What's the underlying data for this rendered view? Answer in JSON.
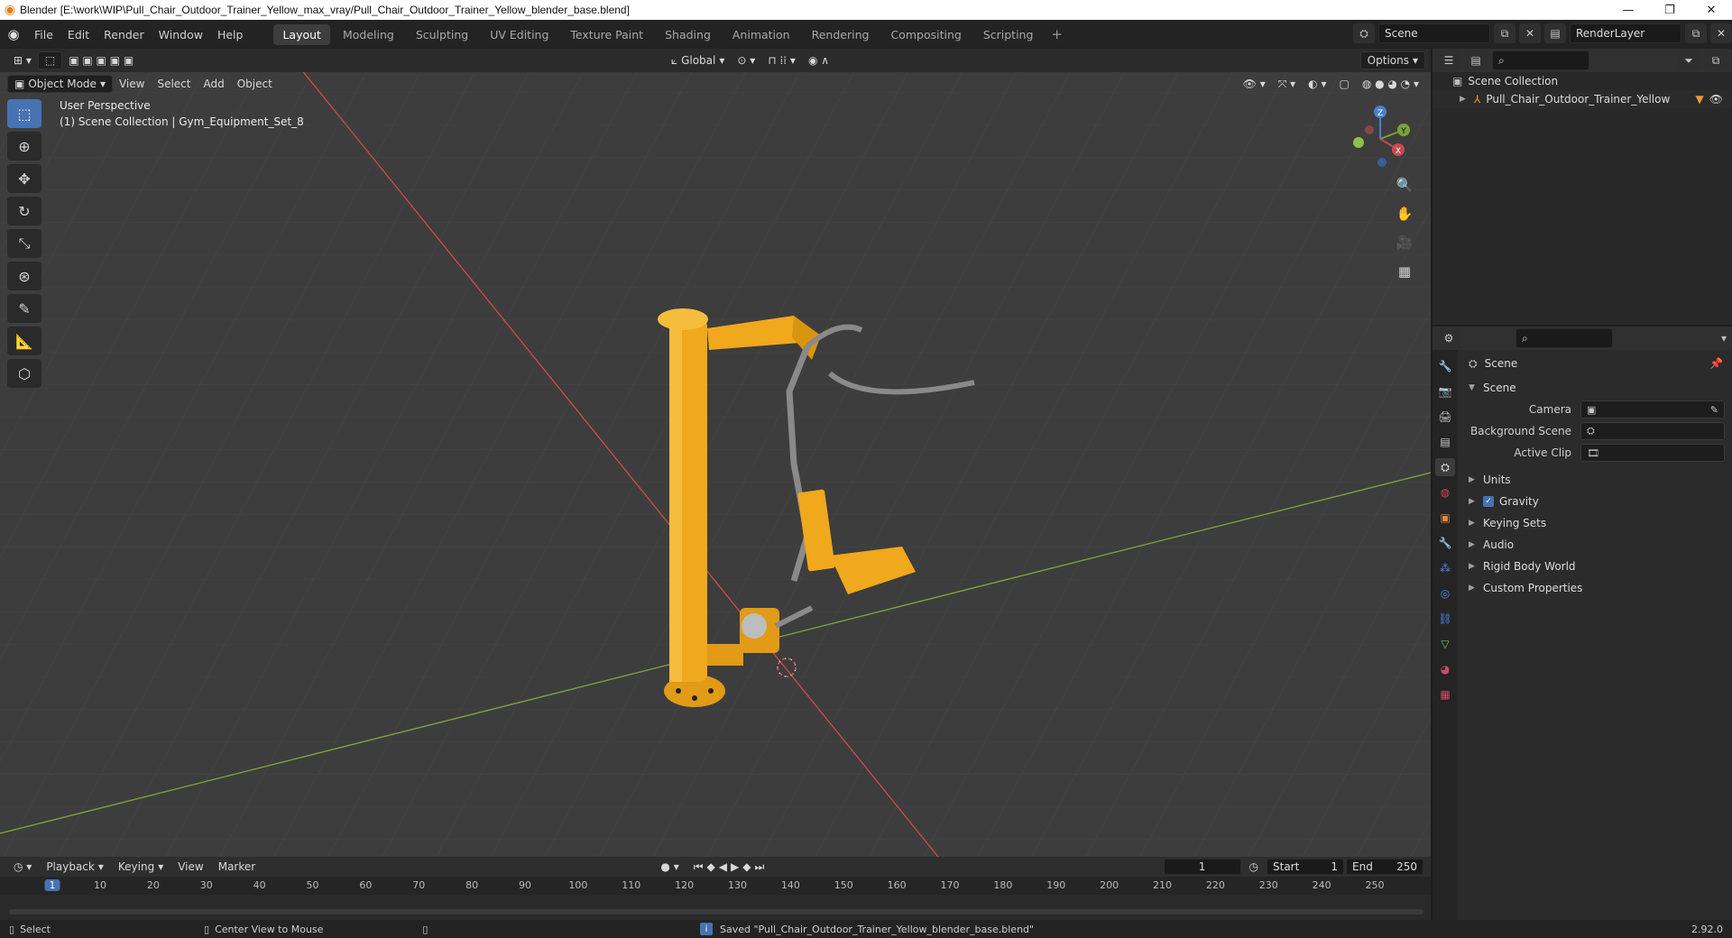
{
  "window": {
    "title": "Blender [E:\\work\\WIP\\Pull_Chair_Outdoor_Trainer_Yellow_max_vray/Pull_Chair_Outdoor_Trainer_Yellow_blender_base.blend]",
    "minimize": "—",
    "maximize": "❐",
    "close": "✕"
  },
  "menus": [
    "File",
    "Edit",
    "Render",
    "Window",
    "Help"
  ],
  "workspaces": [
    "Layout",
    "Modeling",
    "Sculpting",
    "UV Editing",
    "Texture Paint",
    "Shading",
    "Animation",
    "Rendering",
    "Compositing",
    "Scripting"
  ],
  "active_workspace": "Layout",
  "topbar_right": {
    "scene": "Scene",
    "view_layer": "RenderLayer"
  },
  "viewport": {
    "transform_orientation": "Global",
    "options_label": "Options",
    "mode": "Object Mode",
    "menu": [
      "View",
      "Select",
      "Add",
      "Object"
    ],
    "overlay_line1": "User Perspective",
    "overlay_line2": "(1) Scene Collection | Gym_Equipment_Set_8",
    "gizmo": {
      "x": "X",
      "y": "Y",
      "z": "Z"
    }
  },
  "outliner": {
    "root": "Scene Collection",
    "items": [
      {
        "name": "Pull_Chair_Outdoor_Trainer_Yellow"
      }
    ]
  },
  "properties": {
    "context_title": "Scene",
    "section": "Scene",
    "fields": [
      {
        "label": "Camera",
        "value": ""
      },
      {
        "label": "Background Scene",
        "value": ""
      },
      {
        "label": "Active Clip",
        "value": ""
      }
    ],
    "panels": [
      "Units",
      "Gravity",
      "Keying Sets",
      "Audio",
      "Rigid Body World",
      "Custom Properties"
    ],
    "gravity_checked": true
  },
  "timeline": {
    "menus": [
      "Playback",
      "Keying",
      "View",
      "Marker"
    ],
    "current_frame": "1",
    "start_label": "Start",
    "start": "1",
    "end_label": "End",
    "end": "250",
    "ruler": [
      "1",
      "10",
      "20",
      "30",
      "40",
      "50",
      "60",
      "70",
      "80",
      "90",
      "100",
      "110",
      "120",
      "130",
      "140",
      "150",
      "160",
      "170",
      "180",
      "190",
      "200",
      "210",
      "220",
      "230",
      "240",
      "250"
    ]
  },
  "statusbar": {
    "left": "Select",
    "middle": "Center View to Mouse",
    "message": "Saved \"Pull_Chair_Outdoor_Trainer_Yellow_blender_base.blend\"",
    "version": "2.92.0"
  },
  "colors": {
    "accent": "#4772b3",
    "equipment_yellow": "#f0a81c",
    "metal_gray": "#8a8a8a",
    "x_axis": "#c84a4a",
    "y_axis": "#7aa23a"
  }
}
